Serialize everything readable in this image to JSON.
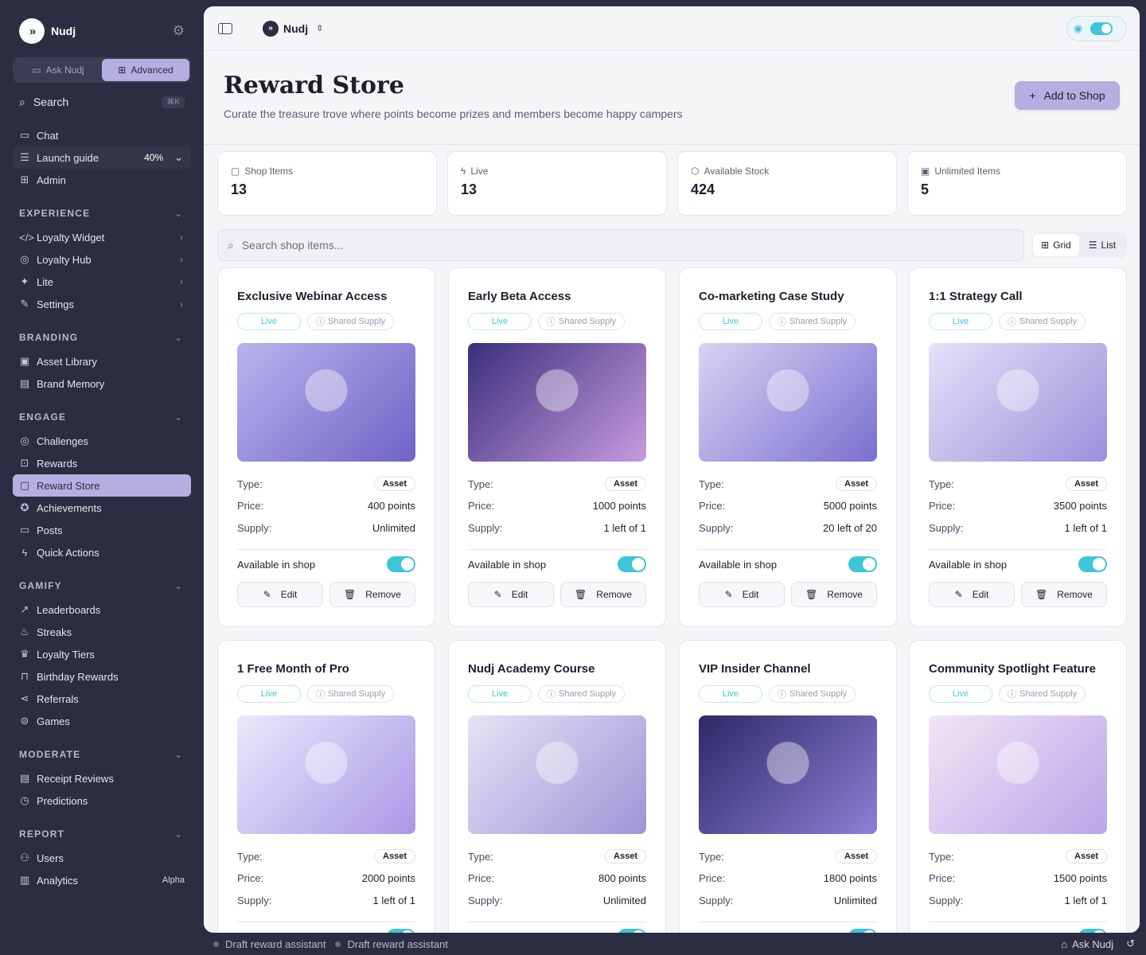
{
  "sidebar": {
    "brand": "Nudj",
    "modes": [
      "Ask Nudj",
      "Advanced"
    ],
    "search": {
      "label": "Search",
      "shortcut": "⌘K"
    },
    "top": [
      {
        "label": "Chat",
        "icon": "chat-icon"
      },
      {
        "label": "Launch guide",
        "icon": "checklist-icon",
        "progress": "40%"
      },
      {
        "label": "Admin",
        "icon": "grid-icon"
      }
    ],
    "groups": [
      {
        "title": "EXPERIENCE",
        "items": [
          {
            "label": "Loyalty Widget",
            "icon": "code-icon"
          },
          {
            "label": "Loyalty Hub",
            "icon": "globe-icon"
          },
          {
            "label": "Lite",
            "icon": "sparkle-icon"
          },
          {
            "label": "Settings",
            "icon": "brush-icon"
          }
        ]
      },
      {
        "title": "BRANDING",
        "items": [
          {
            "label": "Asset Library",
            "icon": "image-icon"
          },
          {
            "label": "Brand Memory",
            "icon": "book-icon"
          }
        ]
      },
      {
        "title": "ENGAGE",
        "items": [
          {
            "label": "Challenges",
            "icon": "target-icon"
          },
          {
            "label": "Rewards",
            "icon": "gift-icon"
          },
          {
            "label": "Reward Store",
            "icon": "store-icon"
          },
          {
            "label": "Achievements",
            "icon": "medal-icon"
          },
          {
            "label": "Posts",
            "icon": "post-icon"
          },
          {
            "label": "Quick Actions",
            "icon": "bolt-icon"
          }
        ]
      },
      {
        "title": "GAMIFY",
        "items": [
          {
            "label": "Leaderboards",
            "icon": "trend-icon"
          },
          {
            "label": "Streaks",
            "icon": "flame-icon"
          },
          {
            "label": "Loyalty Tiers",
            "icon": "trophy-icon"
          },
          {
            "label": "Birthday Rewards",
            "icon": "cake-icon"
          },
          {
            "label": "Referrals",
            "icon": "share-icon"
          },
          {
            "label": "Games",
            "icon": "gamepad-icon"
          }
        ]
      },
      {
        "title": "MODERATE",
        "items": [
          {
            "label": "Receipt Reviews",
            "icon": "receipt-icon"
          },
          {
            "label": "Predictions",
            "icon": "clock-icon"
          }
        ]
      },
      {
        "title": "REPORT",
        "items": [
          {
            "label": "Users",
            "icon": "users-icon"
          },
          {
            "label": "Analytics",
            "icon": "chart-icon",
            "badge": "Alpha"
          }
        ]
      }
    ]
  },
  "topbar": {
    "workspace": "Nudj"
  },
  "header": {
    "title": "Reward Store",
    "subtitle": "Curate the treasure trove where points become prizes and members become happy campers",
    "add_button": "Add to Shop"
  },
  "stats": [
    {
      "label": "Shop Items",
      "value": "13",
      "icon": "store-icon"
    },
    {
      "label": "Live",
      "value": "13",
      "icon": "bolt-icon"
    },
    {
      "label": "Available Stock",
      "value": "424",
      "icon": "box-icon"
    },
    {
      "label": "Unlimited Items",
      "value": "5",
      "icon": "calendar-icon"
    }
  ],
  "search": {
    "placeholder": "Search shop items..."
  },
  "view": {
    "grid": "Grid",
    "list": "List"
  },
  "labels": {
    "live": "Live",
    "shared": "Shared Supply",
    "type": "Type:",
    "price": "Price:",
    "supply": "Supply:",
    "available": "Available in shop",
    "edit": "Edit",
    "remove": "Remove"
  },
  "items": [
    {
      "name": "Exclusive Webinar Access",
      "type": "Asset",
      "price": "400 points",
      "supply": "Unlimited",
      "colors": [
        "#b8b4ec",
        "#6f63c6"
      ]
    },
    {
      "name": "Early Beta Access",
      "type": "Asset",
      "price": "1000 points",
      "supply": "1 left of 1",
      "colors": [
        "#3a2f7a",
        "#c79be0"
      ]
    },
    {
      "name": "Co-marketing Case Study",
      "type": "Asset",
      "price": "5000 points",
      "supply": "20 left of 20",
      "colors": [
        "#d7d4f2",
        "#7a6fd0"
      ]
    },
    {
      "name": "1:1 Strategy Call",
      "type": "Asset",
      "price": "3500 points",
      "supply": "1 left of 1",
      "colors": [
        "#e6e1f7",
        "#9d8fdc"
      ]
    },
    {
      "name": "1 Free Month of Pro",
      "type": "Asset",
      "price": "2000 points",
      "supply": "1 left of 1",
      "colors": [
        "#ece8fb",
        "#a898e6"
      ]
    },
    {
      "name": "Nudj Academy Course",
      "type": "Asset",
      "price": "800 points",
      "supply": "Unlimited",
      "colors": [
        "#e7e3f6",
        "#9f93d6"
      ]
    },
    {
      "name": "VIP Insider Channel",
      "type": "Asset",
      "price": "1800 points",
      "supply": "Unlimited",
      "colors": [
        "#2d2a66",
        "#8d7fd6"
      ]
    },
    {
      "name": "Community Spotlight Feature",
      "type": "Asset",
      "price": "1500 points",
      "supply": "1 left of 1",
      "colors": [
        "#f0e6f6",
        "#b9a6e8"
      ]
    }
  ],
  "footer": {
    "drafts": [
      "Draft reward assistant",
      "Draft reward assistant"
    ],
    "ask": "Ask Nudj"
  }
}
